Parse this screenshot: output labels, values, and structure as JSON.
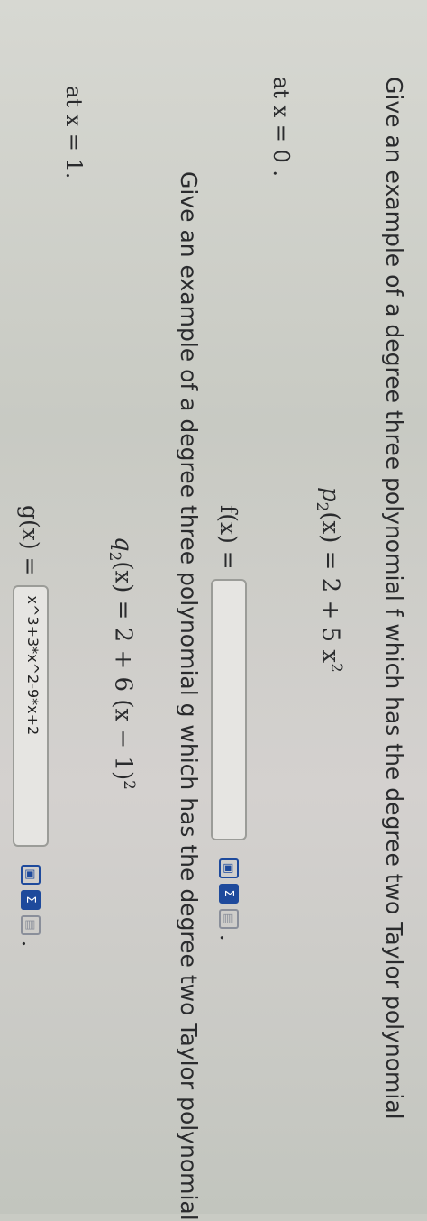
{
  "problem1": {
    "prompt": "Give an example of a degree three polynomial f which has the degree two Taylor polynomial",
    "taylor_label": "p",
    "taylor_sub": "2",
    "taylor_rhs": "(x) = 2 + 5 x",
    "taylor_exp": "2",
    "at_text": "at x = 0 .",
    "answer_label": "f(x) =",
    "answer_value": ""
  },
  "problem2": {
    "prompt": "Give an example of a degree three polynomial g which has the degree two Taylor polynomial",
    "taylor_label": "q",
    "taylor_sub": "2",
    "taylor_rhs": "(x) = 2 + 6 (x − 1)",
    "taylor_exp": "2",
    "at_text": "at x = 1.",
    "answer_label": "g(x) =",
    "answer_value": "x^3+3*x^2-9*x+2"
  },
  "icons": [
    "image-icon",
    "sigma-icon",
    "preview-icon"
  ],
  "colors": {
    "accent": "#1e4a9c",
    "input_border": "#9b9c98"
  }
}
